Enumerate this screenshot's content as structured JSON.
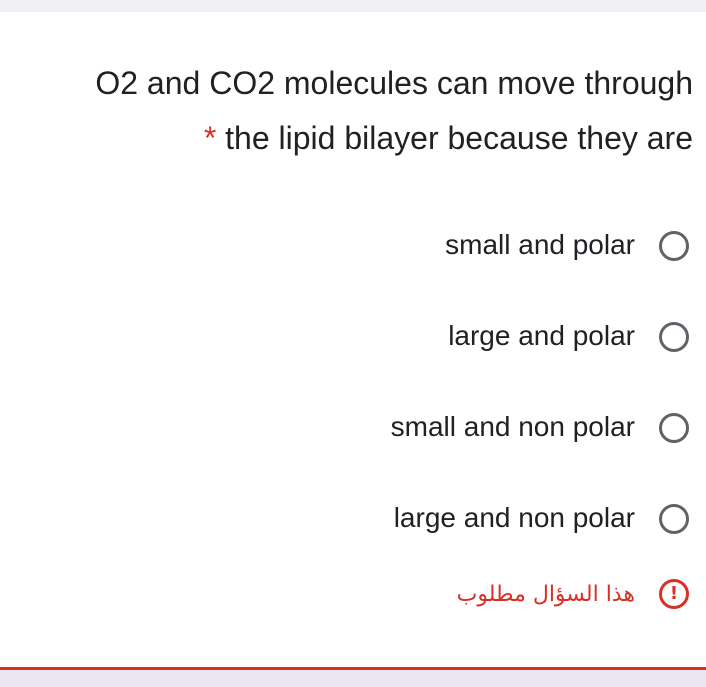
{
  "question": {
    "line1": "O2 and CO2 molecules can move through",
    "line2": "the lipid bilayer because they are",
    "required_marker": "*"
  },
  "options": [
    {
      "label": "small and polar"
    },
    {
      "label": "large and polar"
    },
    {
      "label": "small and non polar"
    },
    {
      "label": "large and non polar"
    }
  ],
  "error": {
    "icon_text": "!",
    "message": "هذا السؤال مطلوب",
    "icon": "exclamation-circle-icon"
  },
  "colors": {
    "text": "#202124",
    "radio_border": "#5f6368",
    "error": "#d93025",
    "page_tint": "#eae7f3"
  }
}
